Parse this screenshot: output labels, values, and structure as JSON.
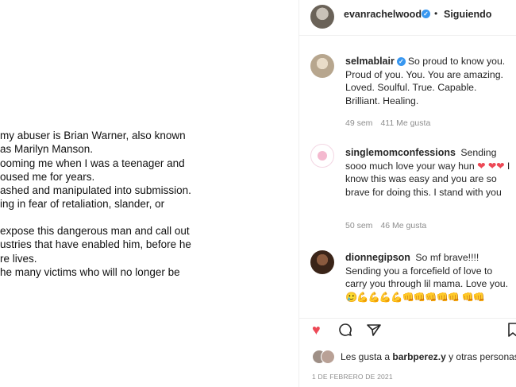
{
  "post_image": {
    "lines": [
      "my abuser is Brian Warner, also known",
      "as Marilyn Manson.",
      "ooming me when I was a teenager and",
      "oused me for years.",
      "ashed and manipulated into submission.",
      "ing in fear of retaliation, slander, or",
      "",
      "expose this dangerous man and call out",
      "ustries that have enabled him, before he",
      "re lives.",
      "he many victims who will no longer be"
    ]
  },
  "header": {
    "username": "evanrachelwood",
    "verified": true,
    "separator": "•",
    "follow_status": "Siguiendo"
  },
  "comments": [
    {
      "username": "selmablair",
      "verified": true,
      "text": "So proud to know you. Proud of you. You. You are amazing. Loved. Soulful. True. Capable. Brilliant. Healing.",
      "age": "49 sem",
      "likes": "411 Me gusta"
    },
    {
      "username": "singlemomconfessions",
      "verified": false,
      "text_before": "Sending sooo much love your way hun",
      "hearts_1": "❤",
      "hearts_2": "❤❤",
      "text_after": "I know this was easy and you are so brave for doing this. I stand with you",
      "age": "50 sem",
      "likes": "46 Me gusta"
    },
    {
      "username": "dionnegipson",
      "verified": false,
      "text": "So mf brave!!!! Sending you a forcefield of love to carry you through lil mama. Love you.",
      "emoji": "🥲💪💪💪💪👊👊👊👊👊",
      "emoji_line2": "👊👊"
    }
  ],
  "actions": {
    "like_icon": "heart-icon",
    "comment_icon": "comment-bubble-icon",
    "share_icon": "paper-plane-icon",
    "save_icon": "bookmark-icon"
  },
  "likes_summary": {
    "prefix": "Les gusta a ",
    "user": "barbperez.y",
    "suffix": " y otras personas"
  },
  "date": "1 DE FEBRERO DE 2021",
  "colors": {
    "verified_blue": "#3897f0",
    "like_red": "#ed4956",
    "meta_gray": "#8e8e8e"
  }
}
